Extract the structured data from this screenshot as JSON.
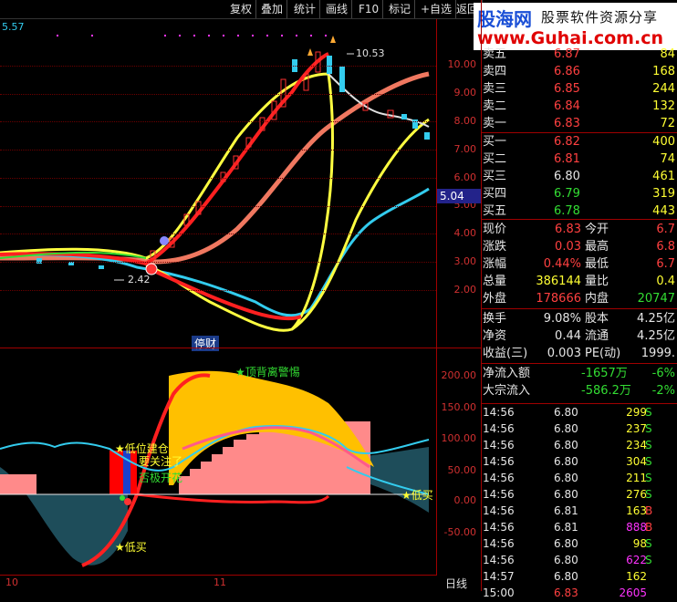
{
  "toolbar": {
    "items": [
      "复权",
      "叠加",
      "统计",
      "画线",
      "F10",
      "标记",
      "+自选",
      "返回"
    ]
  },
  "watermark": {
    "cn": "股海网",
    "slogan": "股票软件资源分享",
    "url": "www.Guhai.com.cn"
  },
  "main_chart": {
    "corner_value": "5.57",
    "high_label": "10.53",
    "low_label": "2.42",
    "current_price_tag": "5.04",
    "y_ticks": [
      "10.00",
      "9.00",
      "8.00",
      "7.00",
      "6.00",
      "5.00",
      "4.00",
      "3.00",
      "2.00"
    ],
    "bottom_label": "停财"
  },
  "indicator": {
    "y_ticks": [
      "200.00",
      "150.00",
      "100.00",
      "50.00",
      "0.00",
      "-50.00"
    ],
    "labels": {
      "peak_warning": "顶背离警惕",
      "low_build": "低位建仓",
      "attention": "要关注了",
      "bloom": "否极开花",
      "low_buy_1": "低买",
      "low_buy_2": "低买"
    }
  },
  "x_axis": {
    "left": "10",
    "mid": "11",
    "period": "日线"
  },
  "order_book": {
    "asks": [
      {
        "label": "卖五",
        "price": "6.87",
        "vol": "84"
      },
      {
        "label": "卖四",
        "price": "6.86",
        "vol": "168"
      },
      {
        "label": "卖三",
        "price": "6.85",
        "vol": "244"
      },
      {
        "label": "卖二",
        "price": "6.84",
        "vol": "132"
      },
      {
        "label": "卖一",
        "price": "6.83",
        "vol": "72"
      }
    ],
    "bids": [
      {
        "label": "买一",
        "price": "6.82",
        "vol": "400"
      },
      {
        "label": "买二",
        "price": "6.81",
        "vol": "74"
      },
      {
        "label": "买三",
        "price": "6.80",
        "vol": "461"
      },
      {
        "label": "买四",
        "price": "6.79",
        "vol": "319"
      },
      {
        "label": "买五",
        "price": "6.78",
        "vol": "443"
      }
    ]
  },
  "quote": {
    "rows": [
      {
        "k1": "现价",
        "v1": "6.83",
        "k2": "今开",
        "v2": "6.7"
      },
      {
        "k1": "涨跌",
        "v1": "0.03",
        "k2": "最高",
        "v2": "6.8"
      },
      {
        "k1": "涨幅",
        "v1": "0.44%",
        "k2": "最低",
        "v2": "6.7"
      },
      {
        "k1": "总量",
        "v1": "386144",
        "k2": "量比",
        "v2": "0.4"
      },
      {
        "k1": "外盘",
        "v1": "178666",
        "k2": "内盘",
        "v2": "20747"
      }
    ],
    "rows2": [
      {
        "k1": "换手",
        "v1": "9.08%",
        "k2": "股本",
        "v2": "4.25亿"
      },
      {
        "k1": "净资",
        "v1": "0.44",
        "k2": "流通",
        "v2": "4.25亿"
      },
      {
        "k1": "收益(三)",
        "v1": "0.003",
        "k2": "PE(动)",
        "v2": "1999."
      }
    ],
    "flows": [
      {
        "k": "净流入额",
        "v": "-1657万",
        "p": "-6%"
      },
      {
        "k": "大宗流入",
        "v": "-586.2万",
        "p": "-2%"
      }
    ]
  },
  "ticks": [
    {
      "time": "14:56",
      "price": "6.80",
      "vol": "299",
      "side": "S"
    },
    {
      "time": "14:56",
      "price": "6.80",
      "vol": "237",
      "side": "S"
    },
    {
      "time": "14:56",
      "price": "6.80",
      "vol": "234",
      "side": "S"
    },
    {
      "time": "14:56",
      "price": "6.80",
      "vol": "304",
      "side": "S"
    },
    {
      "time": "14:56",
      "price": "6.80",
      "vol": "211",
      "side": "S"
    },
    {
      "time": "14:56",
      "price": "6.80",
      "vol": "276",
      "side": "S"
    },
    {
      "time": "14:56",
      "price": "6.81",
      "vol": "163",
      "side": "B"
    },
    {
      "time": "14:56",
      "price": "6.81",
      "vol": "888",
      "side": "B"
    },
    {
      "time": "14:56",
      "price": "6.80",
      "vol": "98",
      "side": "S"
    },
    {
      "time": "14:56",
      "price": "6.80",
      "vol": "622",
      "side": "S"
    },
    {
      "time": "14:57",
      "price": "6.80",
      "vol": "162",
      "side": ""
    }
  ],
  "ticks_last_extra": {
    "time": "15:00",
    "price": "6.83",
    "vol": "2605"
  }
}
